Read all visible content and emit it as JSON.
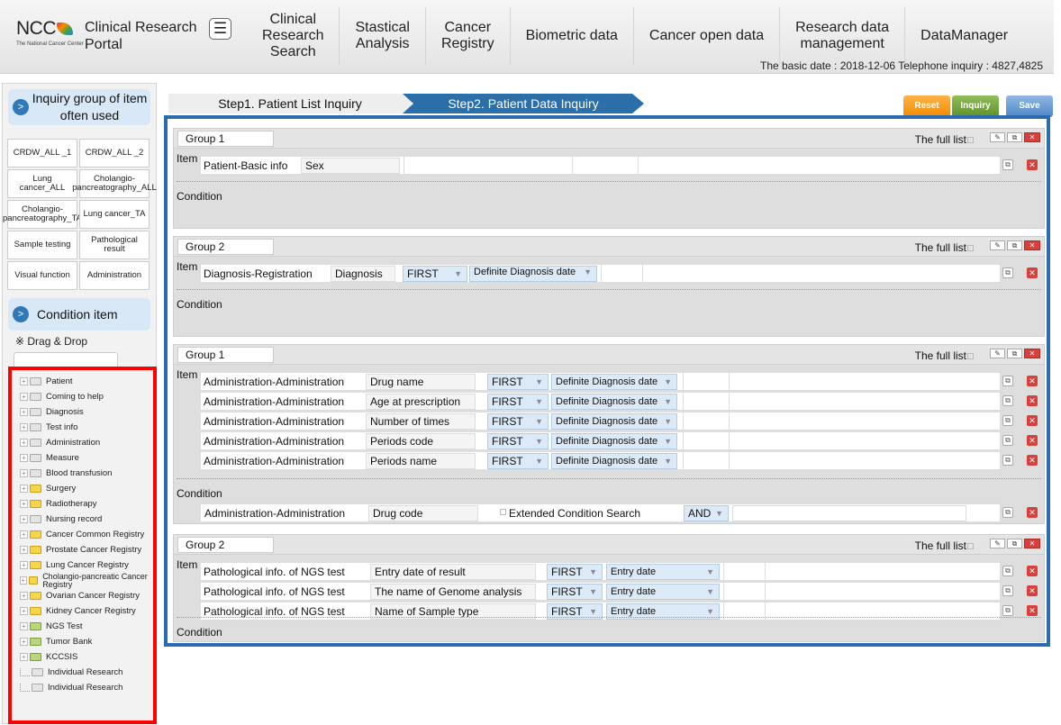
{
  "header": {
    "logo_text": "NCC",
    "logo_subtitle": "The National Cancer Center",
    "portal_title_line1": "Clinical Research",
    "portal_title_line2": "Portal",
    "menu_icon": "☰",
    "nav": [
      {
        "line1": "Clinical",
        "line2": "Research",
        "line3": "Search"
      },
      {
        "line1": "Stastical",
        "line2": "Analysis",
        "line3": ""
      },
      {
        "line1": "Cancer",
        "line2": "Registry",
        "line3": ""
      },
      {
        "line1": "Biometric data",
        "line2": "",
        "line3": ""
      },
      {
        "line1": "Cancer open data",
        "line2": "",
        "line3": ""
      },
      {
        "line1": "Research data",
        "line2": "management",
        "line3": ""
      },
      {
        "line1": "DataManager",
        "line2": "",
        "line3": ""
      }
    ],
    "basic_date": "The basic date : 2018-12-06  Telephone  inquiry : 4827,4825"
  },
  "sidebar": {
    "inquiry_group_title": "Inquiry group of item often used",
    "quick_items": [
      "CRDW_ALL _1",
      "CRDW_ALL _2",
      "Lung cancer_ALL",
      "Cholangio-pancreatography_ALL",
      "Cholangio-pancreatography_TA",
      "Lung cancer_TA",
      "Sample testing",
      "Pathological result",
      "Visual function",
      "Administration"
    ],
    "condition_item_title": "Condition item",
    "drag_drop_note": "※ Drag & Drop",
    "tree": [
      {
        "label": "Patient",
        "folder": "grey"
      },
      {
        "label": "Coming to help",
        "folder": "grey"
      },
      {
        "label": "Diagnosis",
        "folder": "grey"
      },
      {
        "label": "Test info",
        "folder": "grey"
      },
      {
        "label": "Administration",
        "folder": "grey"
      },
      {
        "label": "Measure",
        "folder": "grey"
      },
      {
        "label": "Blood transfusion",
        "folder": "grey"
      },
      {
        "label": "Surgery",
        "folder": "yellow"
      },
      {
        "label": "Radiotherapy",
        "folder": "yellow"
      },
      {
        "label": "Nursing record",
        "folder": "grey"
      },
      {
        "label": "Cancer Common Registry",
        "folder": "yellow"
      },
      {
        "label": "Prostate Cancer Registry",
        "folder": "yellow"
      },
      {
        "label": "Lung Cancer Registry",
        "folder": "yellow"
      },
      {
        "label": "Cholangio-pancreatic Cancer Registry",
        "folder": "yellow"
      },
      {
        "label": "Ovarian Cancer Registry",
        "folder": "yellow"
      },
      {
        "label": "Kidney Cancer Registry",
        "folder": "yellow"
      },
      {
        "label": "NGS Test",
        "folder": "green"
      },
      {
        "label": "Tumor Bank",
        "folder": "green"
      },
      {
        "label": "KCCSIS",
        "folder": "green"
      },
      {
        "label": "Individual Research",
        "folder": "grey"
      },
      {
        "label": "Individual Research",
        "folder": "grey"
      }
    ]
  },
  "steps": {
    "step1": "Step1. Patient List Inquiry",
    "step2": "Step2. Patient Data Inquiry"
  },
  "actions": {
    "reset": "Reset",
    "inquiry": "Inquiry",
    "save": "Save"
  },
  "labels": {
    "item": "Item",
    "condition": "Condition",
    "full_list": "The full list"
  },
  "groups": [
    {
      "name": "Group 1",
      "rows": [
        {
          "category": "Patient-Basic info",
          "field": "Sex",
          "select1": "",
          "select2": ""
        }
      ],
      "conditions": []
    },
    {
      "name": "Group 2",
      "rows": [
        {
          "category": "Diagnosis-Registration",
          "field": "Diagnosis",
          "select1": "FIRST",
          "select2": "Definite Diagnosis date"
        }
      ],
      "conditions": []
    },
    {
      "name": "Group 1",
      "rows": [
        {
          "category": "Administration-Administration",
          "field": "Drug name",
          "select1": "FIRST",
          "select2": "Definite Diagnosis date"
        },
        {
          "category": "Administration-Administration",
          "field": "Age at prescription",
          "select1": "FIRST",
          "select2": "Definite Diagnosis date"
        },
        {
          "category": "Administration-Administration",
          "field": "Number of times",
          "select1": "FIRST",
          "select2": "Definite Diagnosis date"
        },
        {
          "category": "Administration-Administration",
          "field": "Periods code",
          "select1": "FIRST",
          "select2": "Definite Diagnosis date"
        },
        {
          "category": "Administration-Administration",
          "field": "Periods name",
          "select1": "FIRST",
          "select2": "Definite Diagnosis date"
        }
      ],
      "conditions": [
        {
          "category": "Administration-Administration",
          "field": "Drug code",
          "extended": "Extended  Condition Search",
          "operator": "AND"
        }
      ]
    },
    {
      "name": "Group 2",
      "rows": [
        {
          "category": "Pathological  info. of NGS test",
          "field": "Entry date of result",
          "select1": "FIRST",
          "select2": "Entry date"
        },
        {
          "category": "Pathological  info. of NGS test",
          "field": "The name of Genome analysis",
          "select1": "FIRST",
          "select2": "Entry date"
        },
        {
          "category": "Pathological  info. of NGS test",
          "field": "Name of Sample type",
          "select1": "FIRST",
          "select2": "Entry date"
        }
      ],
      "conditions": []
    }
  ]
}
